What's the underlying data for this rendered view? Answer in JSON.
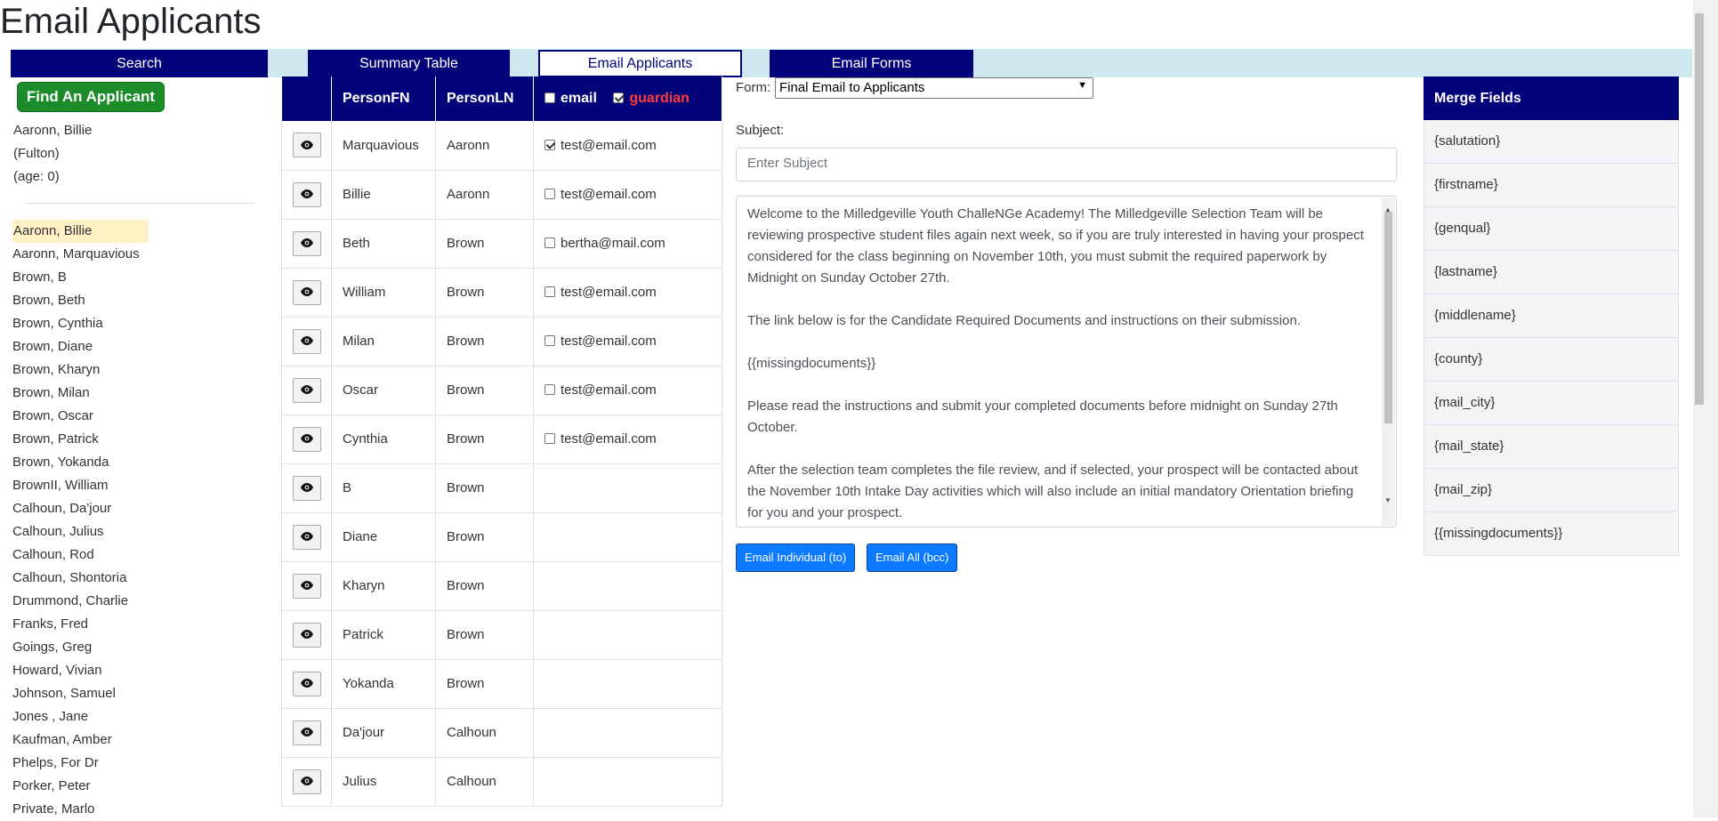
{
  "title": "Email Applicants",
  "nav": {
    "tabs": [
      {
        "label": "Search"
      },
      {
        "label": "Summary Table"
      },
      {
        "label": "Email Applicants"
      },
      {
        "label": "Email Forms"
      }
    ]
  },
  "left": {
    "find_button": "Find An Applicant",
    "selected_name": "Aaronn, Billie",
    "selected_county": "(Fulton)",
    "selected_age": "(age: 0)",
    "applicants": [
      "Aaronn, Billie",
      "Aaronn, Marquavious",
      "Brown, B",
      "Brown, Beth",
      "Brown, Cynthia",
      "Brown, Diane",
      "Brown, Kharyn",
      "Brown, Milan",
      "Brown, Oscar",
      "Brown, Patrick",
      "Brown, Yokanda",
      "BrownII, William",
      "Calhoun, Da'jour",
      "Calhoun, Julius",
      "Calhoun, Rod",
      "Calhoun, Shontoria",
      "Drummond, Charlie",
      "Franks, Fred",
      "Goings, Greg",
      "Howard, Vivian",
      "Johnson, Samuel",
      "Jones , Jane",
      "Kaufman, Amber",
      "Phelps, For Dr",
      "Porker, Peter",
      "Private, Marlo"
    ]
  },
  "table": {
    "headers": {
      "first": "PersonFN",
      "last": "PersonLN",
      "email": "email",
      "guardian": "guardian"
    },
    "rows": [
      {
        "first": "Marquavious",
        "last": "Aaronn",
        "email": "test@email.com",
        "checked": true
      },
      {
        "first": "Billie",
        "last": "Aaronn",
        "email": "test@email.com",
        "checked": false
      },
      {
        "first": "Beth",
        "last": "Brown",
        "email": "bertha@mail.com",
        "checked": false
      },
      {
        "first": "William",
        "last": "Brown",
        "email": "test@email.com",
        "checked": false
      },
      {
        "first": "Milan",
        "last": "Brown",
        "email": "test@email.com",
        "checked": false
      },
      {
        "first": "Oscar",
        "last": "Brown",
        "email": "test@email.com",
        "checked": false
      },
      {
        "first": "Cynthia",
        "last": "Brown",
        "email": "test@email.com",
        "checked": false
      },
      {
        "first": "B",
        "last": "Brown",
        "email": "",
        "checked": false
      },
      {
        "first": "Diane",
        "last": "Brown",
        "email": "",
        "checked": false
      },
      {
        "first": "Kharyn",
        "last": "Brown",
        "email": "",
        "checked": false
      },
      {
        "first": "Patrick",
        "last": "Brown",
        "email": "",
        "checked": false
      },
      {
        "first": "Yokanda",
        "last": "Brown",
        "email": "",
        "checked": false
      },
      {
        "first": "Da'jour",
        "last": "Calhoun",
        "email": "",
        "checked": false
      },
      {
        "first": "Julius",
        "last": "Calhoun",
        "email": "",
        "checked": false
      }
    ]
  },
  "composer": {
    "form_label": "Form:",
    "form_value": "Final Email to Applicants",
    "subject_label": "Subject:",
    "subject_placeholder": "Enter Subject",
    "body": [
      "Welcome to the Milledgeville Youth ChalleNGe Academy! The Milledgeville Selection Team will be reviewing prospective student files again next week, so if you are truly interested in having your prospect considered for the class beginning on November 10th, you must submit the required paperwork by Midnight on Sunday October 27th.",
      "The link below is for the Candidate Required Documents and instructions on their submission.",
      "{{missingdocuments}}",
      "Please read the instructions and submit your completed documents before midnight on Sunday 27th October.",
      "After the selection team completes the file review, and if selected, your prospect will be contacted about the November 10th Intake Day activities which will also include an initial mandatory Orientation briefing for you and your prospect."
    ],
    "btn_individual": "Email Individual (to)",
    "btn_all": "Email All (bcc)"
  },
  "merge": {
    "title": "Merge Fields",
    "fields": [
      "{salutation}",
      "{firstname}",
      "{genqual}",
      "{lastname}",
      "{middlename}",
      "{county}",
      "{mail_city}",
      "{mail_state}",
      "{mail_zip}",
      "{{missingdocuments}}"
    ]
  },
  "colors": {
    "navy": "#03037a",
    "nav_bg": "#cfe8ef",
    "green": "#1c8b2a",
    "blue": "#0d7bff",
    "guardian": "#ff3b3b"
  }
}
